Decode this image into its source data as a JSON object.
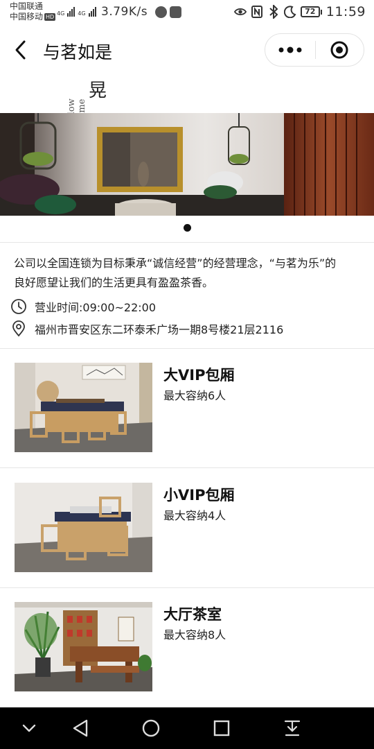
{
  "status_bar": {
    "carrier1": "中国联通",
    "carrier2": "中国移动",
    "hd": "HD",
    "net1": "4G",
    "net2": "4G",
    "speed": "3.79K/s",
    "battery": "72",
    "time": "11:59"
  },
  "nav": {
    "title": "与茗如是"
  },
  "banner": {
    "logo_latin": "slow time",
    "logo_cn": "晃",
    "slide_count": 1,
    "active_slide": 1
  },
  "store": {
    "intro": "公司以全国连锁为目标秉承“诚信经营”的经营理念，“与茗为乐”的良好愿望让我们的生活更具有盈盈茶香。",
    "hours": "营业时间:09:00~22:00",
    "address": "福州市晋安区东二环泰禾广场一期8号楼21层2116"
  },
  "rooms": [
    {
      "name": "大VIP包厢",
      "capacity": "最大容纳6人"
    },
    {
      "name": "小VIP包厢",
      "capacity": "最大容纳4人"
    },
    {
      "name": "大厅茶室",
      "capacity": "最大容纳8人"
    }
  ],
  "colors": {
    "accent": "#111111",
    "divider": "#e6e6e6",
    "system_nav": "#000000"
  },
  "icons": {
    "back": "chevron-left-icon",
    "more": "more-dots-icon",
    "close": "target-circle-icon",
    "hours": "clock-icon",
    "address": "location-pin-icon"
  }
}
